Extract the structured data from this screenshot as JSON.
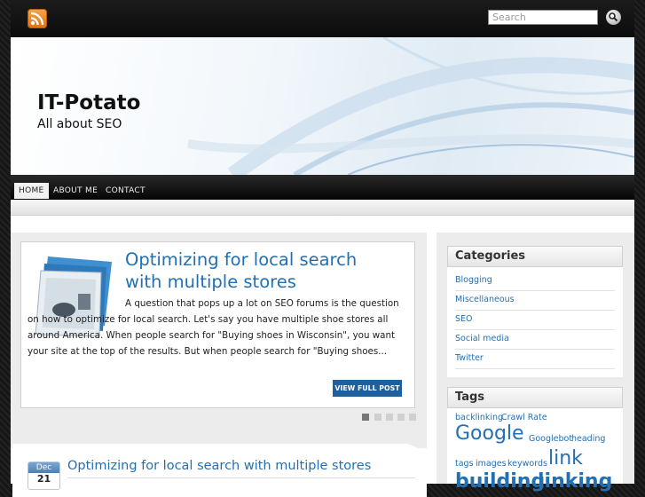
{
  "topbar": {
    "search_placeholder": "Search"
  },
  "header": {
    "site_title": "IT-Potato",
    "tagline": "All about SEO"
  },
  "nav": {
    "items": [
      "HOME",
      "ABOUT ME",
      "CONTACT"
    ],
    "active": "HOME"
  },
  "featured": {
    "title_line1": "Optimizing for local search",
    "title_line2": "with multiple stores",
    "excerpt": "A question that pops up a lot on SEO forums is the question on how to optimize for local search. Let's say you have multiple shoe stores all around America. When people search for \"Buying shoes in Wisconsin\", you want your site at the top of the results. But when people search for \"Buying shoes...",
    "read_more": "VIEW FULL POST",
    "slides": 5,
    "active_slide": 1
  },
  "post": {
    "month": "Dec",
    "day": "21",
    "title": "Optimizing for local search with multiple stores"
  },
  "sidebar": {
    "categories_title": "Categories",
    "categories": [
      "Blogging",
      "Miscellaneous",
      "SEO",
      "Social media",
      "Twitter"
    ],
    "tags_title": "Tags",
    "tags": [
      "backlinking",
      "Crawl Rate",
      "Google",
      "Googlebot",
      "heading",
      "tags",
      "images",
      "keywords",
      "link",
      "building",
      "linking"
    ]
  },
  "colors": {
    "link": "#2270b4",
    "button": "#1f5f9e",
    "rss": "#f08a24"
  }
}
